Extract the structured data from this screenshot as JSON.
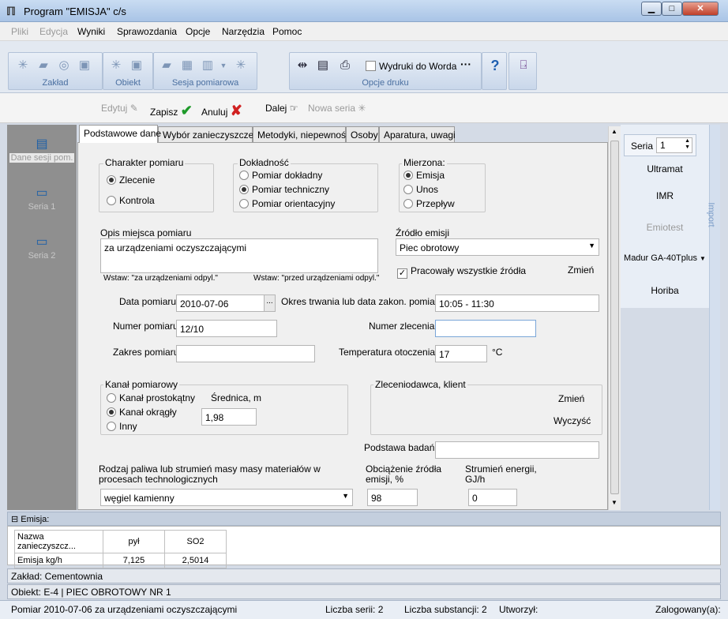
{
  "window": {
    "title": "Program \"EMISJA\" c/s",
    "min": "▁",
    "max": "□",
    "close": "✕"
  },
  "menu": [
    "Pliki",
    "Edycja",
    "Wyniki",
    "Sprawozdania",
    "Opcje",
    "Narzędzia",
    "Pomoc"
  ],
  "ribbon": {
    "groups": [
      "Zakład",
      "Obiekt",
      "Sesja pomiarowa",
      "Opcje druku"
    ],
    "word_export": "Wydruki do Worda",
    "more": "···",
    "help": "?"
  },
  "toolbar2": {
    "edit": "Edytuj",
    "save": "Zapisz",
    "cancel": "Anuluj",
    "next": "Dalej",
    "new_series": "Nowa seria"
  },
  "leftnav": [
    {
      "label": "Dane sesji pom."
    },
    {
      "label": "Seria 1"
    },
    {
      "label": "Seria 2"
    }
  ],
  "tabs": [
    "Podstawowe dane",
    "Wybór zanieczyszczeń",
    "Metodyki, niepewność",
    "Osoby",
    "Aparatura, uwagi"
  ],
  "form": {
    "charakter": {
      "title": "Charakter pomiaru",
      "options": [
        "Zlecenie",
        "Kontrola"
      ],
      "selected": 0
    },
    "dokladnosc": {
      "title": "Dokładność",
      "options": [
        "Pomiar dokładny",
        "Pomiar techniczny",
        "Pomiar orientacyjny"
      ],
      "selected": 1
    },
    "mierzona": {
      "title": "Mierzona:",
      "options": [
        "Emisja",
        "Unos",
        "Przepływ"
      ],
      "selected": 0
    },
    "opis_label": "Opis miejsca pomiaru",
    "opis_value": "za urządzeniami oczyszczającymi",
    "wstaw1": "Wstaw: \"za urządzeniami odpyl.\"",
    "wstaw2": "Wstaw: \"przed urządzeniami odpyl.\"",
    "zrodlo_label": "Źródło emisji",
    "zrodlo_value": "Piec obrotowy",
    "pracowaly": "Pracowały wszystkie źródła",
    "zmien": "Zmień",
    "data_label": "Data pomiaru",
    "data_value": "2010-07-06",
    "data_btn": "...",
    "okres_label": "Okres trwania lub data zakon. pomiaru",
    "okres_value": "10:05 - 11:30",
    "numer_label": "Numer pomiaru",
    "numer_value": "12/10",
    "zlecenie_label": "Numer zlecenia",
    "zlecenie_value": "",
    "zakres_label": "Zakres pomiaru",
    "zakres_value": "",
    "temp_label": "Temperatura otoczenia",
    "temp_value": "17",
    "temp_unit": "°C",
    "kanal": {
      "title": "Kanał pomiarowy",
      "options": [
        "Kanał prostokątny",
        "Kanał okrągły",
        "Inny"
      ],
      "selected": 1,
      "srednica_label": "Średnica, m",
      "srednica_value": "1,98"
    },
    "zleceniodawca": {
      "title": "Zleceniodawca, klient",
      "change": "Zmień",
      "clear": "Wyczyść"
    },
    "podstawa_label": "Podstawa badań",
    "podstawa_value": "",
    "paliwo_label": "Rodzaj paliwa lub strumień masy masy materiałów w procesach technologicznych",
    "paliwo_value": "węgiel kamienny",
    "obciazenie_label": "Obciążenie źródła emisji, %",
    "obciazenie_value": "98",
    "strumien_label": "Strumień energii, GJ/h",
    "strumien_value": "0"
  },
  "rightpanel": {
    "seria_label": "Seria",
    "seria_value": "1",
    "items": [
      "Ultramat",
      "IMR",
      "Emiotest",
      "Madur GA-40Tplus",
      "Horiba"
    ],
    "import": "Import"
  },
  "emisja": {
    "header": "Emisja:",
    "columns": [
      "Nazwa zanieczyszcz...",
      "pył",
      "SO2"
    ],
    "rows": [
      [
        "Emisja kg/h",
        "7,125",
        "2,5014"
      ]
    ]
  },
  "status": {
    "zaklad": "Zakład: Cementownia",
    "obiekt": "Obiekt: E-4 | PIEC OBROTOWY NR 1"
  },
  "statusbar": {
    "pomiar": "Pomiar 2010-07-06 za urządzeniami oczyszczającymi",
    "serie": "Liczba serii: 2",
    "substancje": "Liczba substancji: 2",
    "utworzyl": "Utworzył:",
    "zalogowany": "Zalogowany(a):"
  }
}
